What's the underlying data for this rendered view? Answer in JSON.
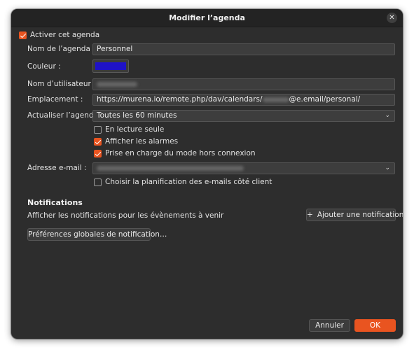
{
  "dialog": {
    "title": "Modifier l’agenda",
    "close_symbol": "✕"
  },
  "form": {
    "enable_label": "Activer cet agenda",
    "enable_checked": true,
    "name_label": "Nom de l’agenda :",
    "name_value": "Personnel",
    "color_label": "Couleur :",
    "color_value": "#1f12c8",
    "username_label": "Nom d’utilisateur :",
    "location_label": "Emplacement :",
    "location_prefix": "https://murena.io/remote.php/dav/calendars/",
    "location_suffix": "@e.email/personal/",
    "refresh_label": "Actualiser l’agenda :",
    "refresh_value": "Toutes les 60 minutes",
    "readonly_label": "En lecture seule",
    "readonly_checked": false,
    "alarms_label": "Afficher les alarmes",
    "alarms_checked": true,
    "offline_label": "Prise en charge du mode hors connexion",
    "offline_checked": true,
    "email_label": "Adresse e-mail :",
    "client_scheduling_label": "Choisir la planification des e-mails côté client",
    "client_scheduling_checked": false
  },
  "notifications": {
    "heading": "Notifications",
    "description": "Afficher les notifications pour les évènements à venir",
    "add_icon": "+",
    "add_label": "Ajouter une notification",
    "global_prefs_label": "Préférences globales de notification…"
  },
  "footer": {
    "cancel_label": "Annuler",
    "ok_label": "OK"
  },
  "colors": {
    "accent": "#e95420",
    "background": "#2d2d2d"
  }
}
